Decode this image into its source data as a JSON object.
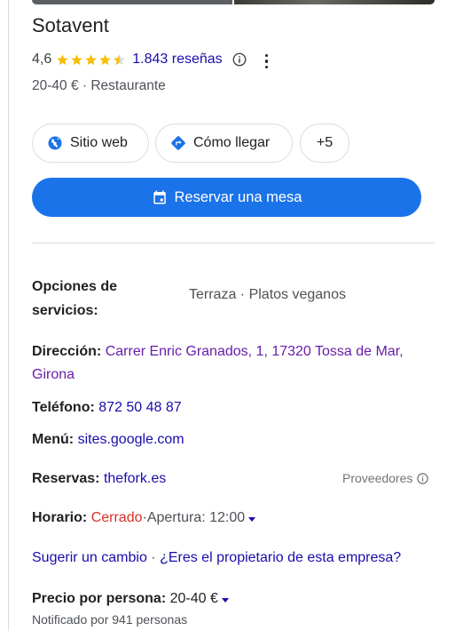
{
  "business": {
    "name": "Sotavent",
    "rating": "4,6",
    "stars_filled_fraction": 0.9,
    "reviews": "1.843 reseñas",
    "price_range": "20-40 €",
    "separator": " · ",
    "category": "Restaurante"
  },
  "actions": {
    "website": "Sitio web",
    "directions": "Cómo llegar",
    "more": "+5",
    "reserve": "Reservar una mesa"
  },
  "details": {
    "service_options_label": "Opciones de servicios:",
    "service_options_value": "Terraza · Platos veganos",
    "address_label": "Dirección:",
    "address_value": "Carrer Enric Granados, 1, 17320 Tossa de Mar, Girona",
    "phone_label": "Teléfono:",
    "phone_value": "872 50 48 87",
    "menu_label": "Menú:",
    "menu_value": "sites.google.com",
    "reservations_label": "Reservas:",
    "reservations_value": "thefork.es",
    "providers_label": "Proveedores",
    "hours_label": "Horario:",
    "hours_status": "Cerrado",
    "hours_next": "Apertura: 12:00",
    "suggest_edit": "Sugerir un cambio",
    "owner_question": "¿Eres el propietario de esta empresa?",
    "price_per_person_label": "Precio por persona:",
    "price_per_person_value": "20-40 €",
    "price_note": "Notificado por 941 personas"
  },
  "colors": {
    "primary": "#1a73e8",
    "link": "#1a0dab",
    "visited": "#681da8",
    "star": "#fbbc04",
    "closed": "#d93025"
  }
}
